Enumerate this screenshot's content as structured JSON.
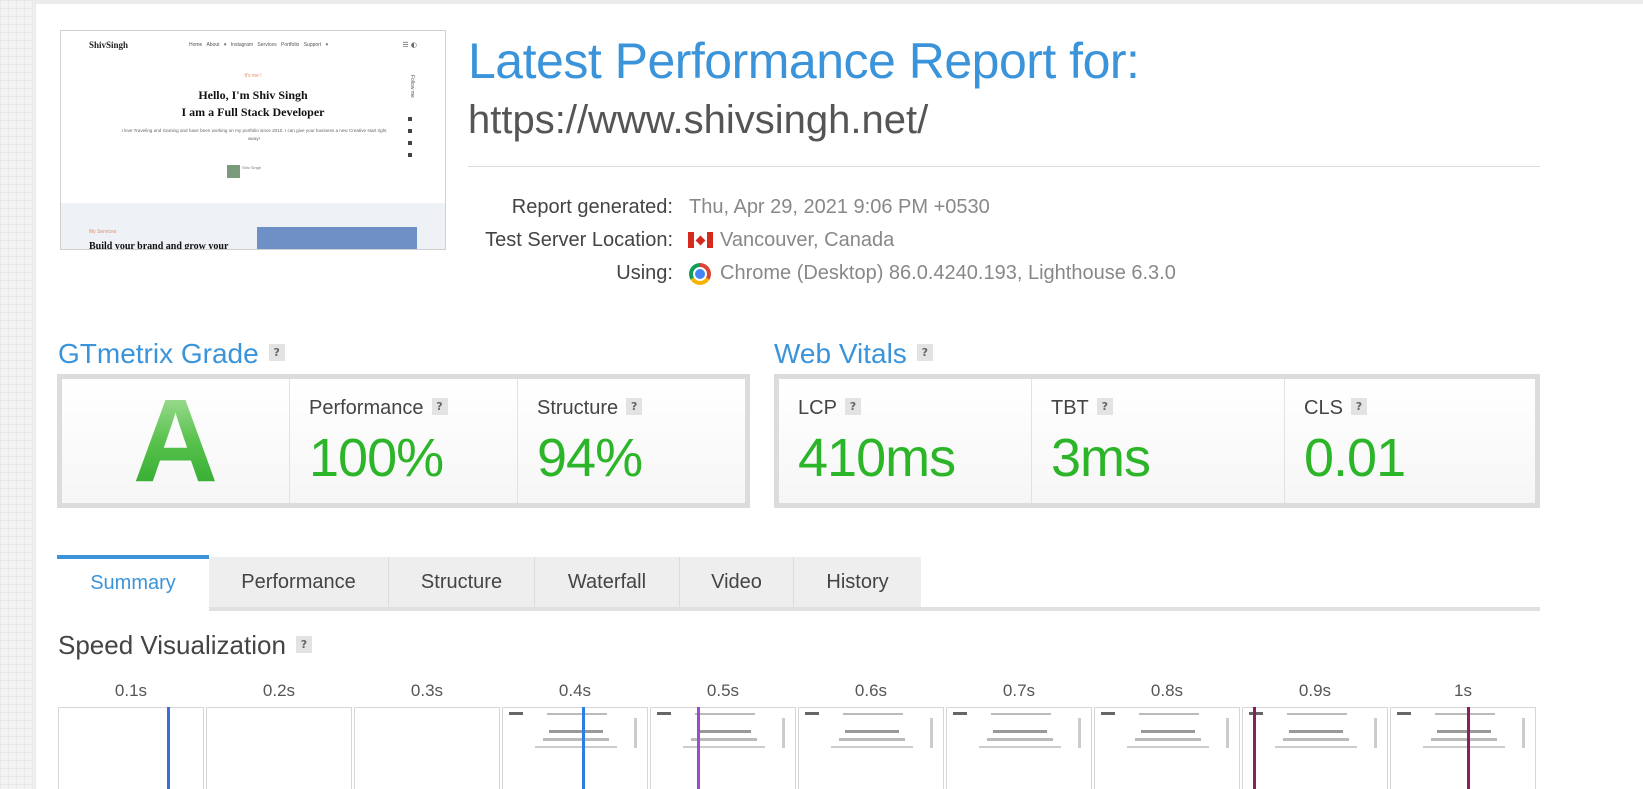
{
  "header": {
    "title": "Latest Performance Report for:",
    "url": "https://www.shivsingh.net/"
  },
  "thumbnail": {
    "logo": "ShivSingh",
    "nav_links": "Home About ▾ Instagram Services Portfolio Support ▾",
    "greeting": "It's me !",
    "headline_1": "Hello, I'm Shiv Singh",
    "headline_2": "I am a Full Stack Developer",
    "intro": "I love Traveling and Gaming and have been working on my portfolio since 2010. I can give your business a new Creative start right away!",
    "avatar_caption": "Shiv Singh",
    "follow": "Follow me",
    "services_label": "My Services",
    "services_heading": "Build your brand and grow your"
  },
  "meta": {
    "report_generated_label": "Report generated:",
    "report_generated_value": "Thu, Apr 29, 2021 9:06 PM +0530",
    "server_label": "Test Server Location:",
    "server_value": "Vancouver, Canada",
    "using_label": "Using:",
    "using_value": "Chrome (Desktop) 86.0.4240.193, Lighthouse 6.3.0"
  },
  "grade": {
    "title": "GTmetrix Grade",
    "help": "?",
    "letter": "A",
    "performance_label": "Performance",
    "performance_value": "100%",
    "structure_label": "Structure",
    "structure_value": "94%"
  },
  "vitals": {
    "title": "Web Vitals",
    "help": "?",
    "lcp_label": "LCP",
    "lcp_value": "410ms",
    "tbt_label": "TBT",
    "tbt_value": "3ms",
    "cls_label": "CLS",
    "cls_value": "0.01"
  },
  "tabs": [
    {
      "label": "Summary"
    },
    {
      "label": "Performance"
    },
    {
      "label": "Structure"
    },
    {
      "label": "Waterfall"
    },
    {
      "label": "Video"
    },
    {
      "label": "History"
    }
  ],
  "speed": {
    "title": "Speed Visualization",
    "help": "?",
    "timeline": [
      "0.1s",
      "0.2s",
      "0.3s",
      "0.4s",
      "0.5s",
      "0.6s",
      "0.7s",
      "0.8s",
      "0.9s",
      "1s"
    ]
  },
  "colors": {
    "accent_blue": "#3b94d9",
    "good_green": "#2db52a",
    "marker_blue": "#3b6fd8",
    "marker_purple": "#9b4bcf",
    "marker_maroon": "#8a1f5e"
  }
}
